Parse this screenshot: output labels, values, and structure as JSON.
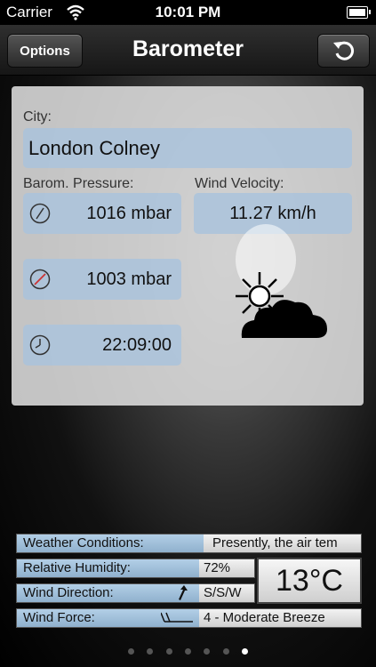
{
  "status_bar": {
    "carrier": "Carrier",
    "time": "10:01 PM",
    "icons": [
      "wifi-icon",
      "battery-icon"
    ]
  },
  "nav": {
    "title": "Barometer",
    "options_label": "Options",
    "refresh_icon": "refresh-icon"
  },
  "panel": {
    "city_label": "City:",
    "city_value": "London Colney",
    "pressure_label": "Barom. Pressure:",
    "wind_label": "Wind Velocity:",
    "wind_value": "11.27 km/h",
    "pressure_current": "1016 mbar",
    "pressure_reference": "1003 mbar",
    "time_value": "22:09:00",
    "icons": [
      "gauge-icon",
      "gauge-red-icon",
      "clock-icon",
      "partly-cloudy-icon"
    ]
  },
  "info": {
    "conditions_label": "Weather Conditions:",
    "conditions_value": "Presently, the air tem",
    "humidity_label": "Relative Humidity:",
    "humidity_value": "72%",
    "direction_label": "Wind Direction:",
    "direction_value": "S/S/W",
    "force_label": "Wind Force:",
    "force_value": "4 - Moderate Breeze",
    "temperature": "13°C"
  },
  "page_indicator": {
    "count": 7,
    "active_index": 6
  },
  "colors": {
    "field_blue": "#aac3dc",
    "nav_dark": "#161616"
  }
}
